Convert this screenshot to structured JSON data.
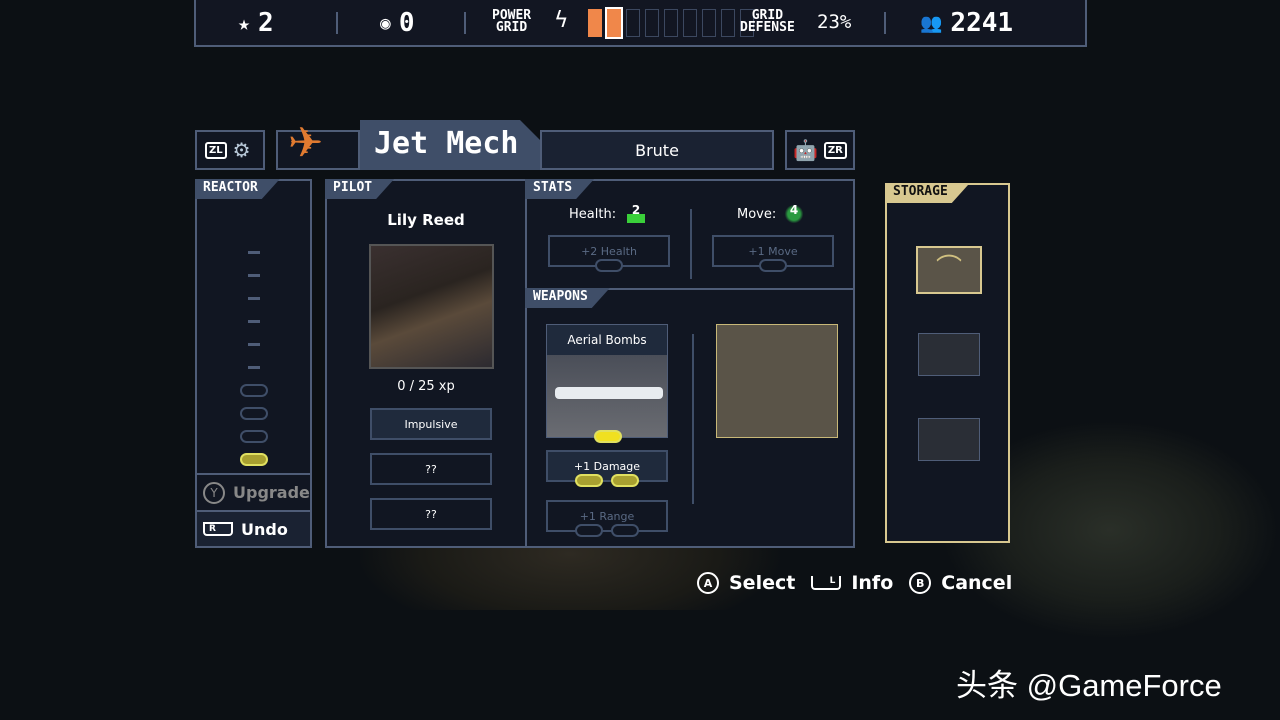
{
  "topbar": {
    "stars": "2",
    "reputation": "0",
    "power_grid_label": "POWER\nGRID",
    "power_segments_filled": 2,
    "power_segments_total": 9,
    "grid_defense_label": "GRID\nDEFENSE",
    "grid_defense": "23%",
    "population": "2241",
    "accent": "#f0874a"
  },
  "header": {
    "prev_button": "ZL",
    "next_button": "ZR",
    "mech_name": "Jet Mech",
    "mech_class": "Brute"
  },
  "reactor": {
    "title": "REACTOR",
    "cores_filled": 1,
    "cores_total": 4,
    "upgrade_button": "Y",
    "upgrade_label": "Upgrade",
    "undo_button": "R",
    "undo_label": "Undo"
  },
  "pilot": {
    "title": "PILOT",
    "name": "Lily Reed",
    "xp": "0 / 25 xp",
    "skills": [
      "Impulsive",
      "??",
      "??"
    ]
  },
  "stats": {
    "title": "STATS",
    "health_label": "Health:",
    "health_value": "2",
    "health_upgrade": "+2 Health",
    "move_label": "Move:",
    "move_value": "4",
    "move_upgrade": "+1 Move"
  },
  "weapons": {
    "title": "WEAPONS",
    "weapon_name": "Aerial Bombs",
    "upgrades": [
      {
        "label": "+1 Damage",
        "filled": 2
      },
      {
        "label": "+1 Range",
        "filled": 0
      }
    ]
  },
  "storage": {
    "title": "STORAGE"
  },
  "footer": {
    "select_key": "A",
    "select_label": "Select",
    "info_key": "L",
    "info_label": "Info",
    "cancel_key": "B",
    "cancel_label": "Cancel"
  },
  "watermark": "头条 @GameForce"
}
